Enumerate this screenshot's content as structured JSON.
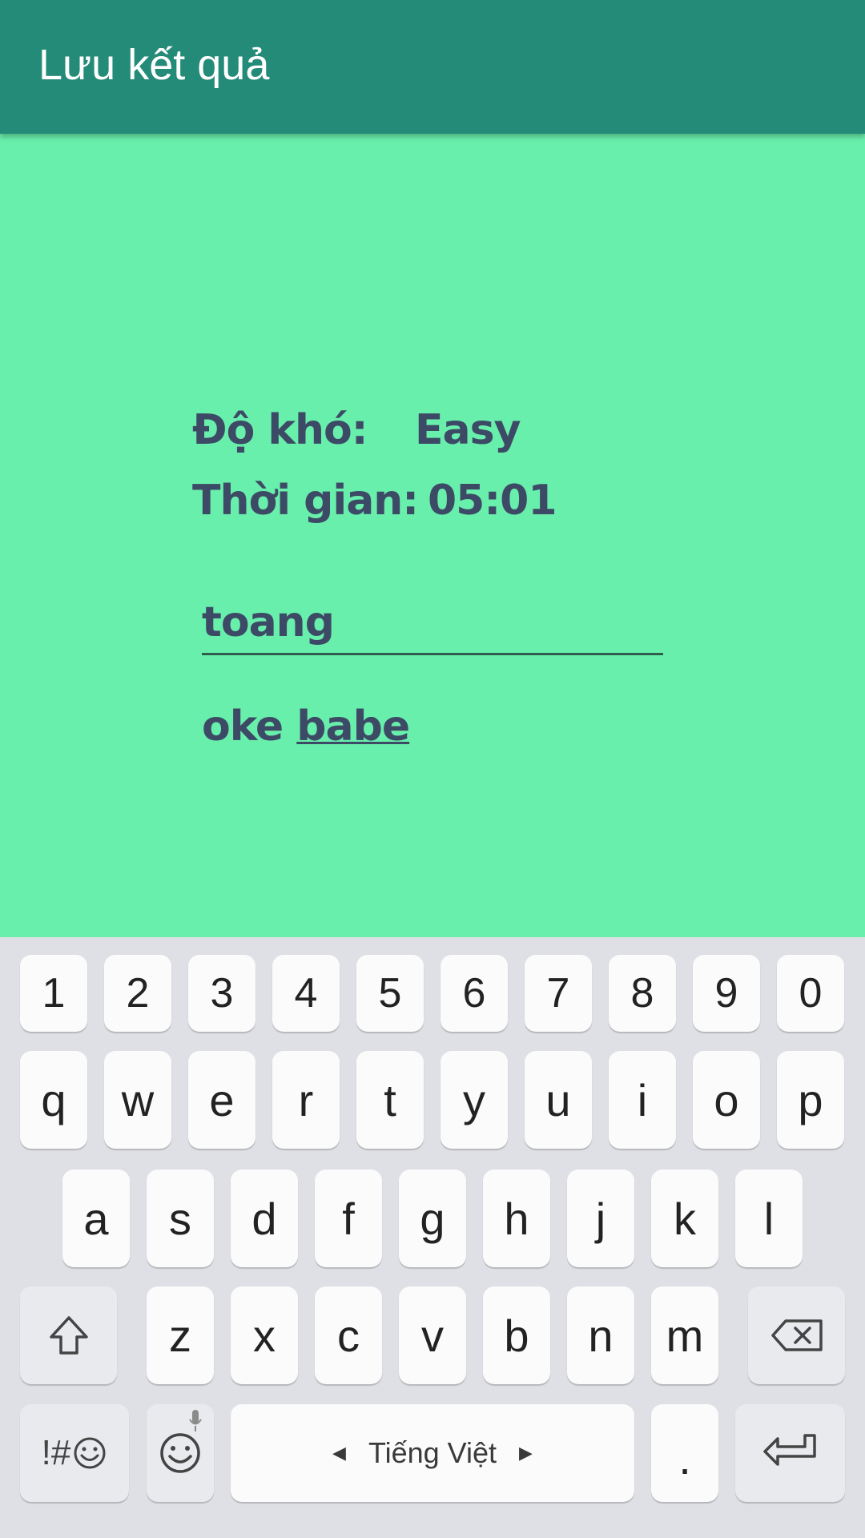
{
  "appbar": {
    "title": "Lưu kết quả"
  },
  "result": {
    "difficulty_label": "Độ khó:",
    "difficulty_value": "Easy",
    "time_label": "Thời gian:",
    "time_value": "05:01"
  },
  "name_input": {
    "value": "toang"
  },
  "save_button": {
    "part1": "oke ",
    "part2": "babe"
  },
  "keyboard": {
    "row_numbers": [
      "1",
      "2",
      "3",
      "4",
      "5",
      "6",
      "7",
      "8",
      "9",
      "0"
    ],
    "row_top": [
      "q",
      "w",
      "e",
      "r",
      "t",
      "y",
      "u",
      "i",
      "o",
      "p"
    ],
    "row_mid": [
      "a",
      "s",
      "d",
      "f",
      "g",
      "h",
      "j",
      "k",
      "l"
    ],
    "row_bottom": [
      "z",
      "x",
      "c",
      "v",
      "b",
      "n",
      "m"
    ],
    "symbols_label": "!#",
    "space_label": "Tiếng Việt",
    "period_label": "."
  },
  "colors": {
    "appbar": "#248b79",
    "background": "#69efac",
    "text": "#3d4a66",
    "keyboard_bg": "#dfe0e5"
  }
}
